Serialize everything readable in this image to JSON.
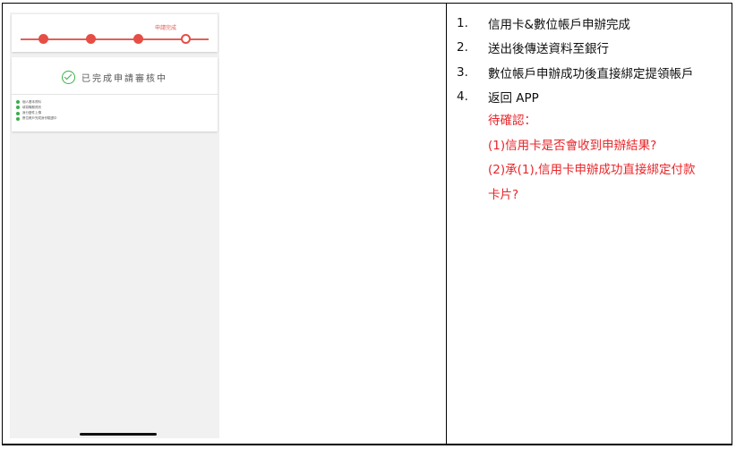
{
  "phone": {
    "stepper": {
      "current_step_label": "申請完成",
      "total_steps": 4,
      "current_step": 4
    },
    "status": {
      "title": "已完成申請審核中",
      "checklist": [
        "個人基本資料",
        "填寫職務資訊",
        "身分證件上傳",
        "數位帳戶完成身份驗證中"
      ]
    }
  },
  "steps": [
    {
      "num": "1.",
      "text": "信用卡&數位帳戶申辦完成"
    },
    {
      "num": "2.",
      "text": "送出後傳送資料至銀行"
    },
    {
      "num": "3.",
      "text": "數位帳戶申辦成功後直接綁定提領帳戶"
    },
    {
      "num": "4.",
      "text": "返回 APP"
    }
  ],
  "notes": {
    "heading": "待確認：",
    "line1": "(1)信用卡是否會收到申辦結果?",
    "line2a": "(2)承(1),信用卡申辦成功直接綁定付款",
    "line2b": "卡片?"
  },
  "colors": {
    "accent": "#e64d45",
    "success": "#3cae4d",
    "note_red": "#e8262a"
  }
}
